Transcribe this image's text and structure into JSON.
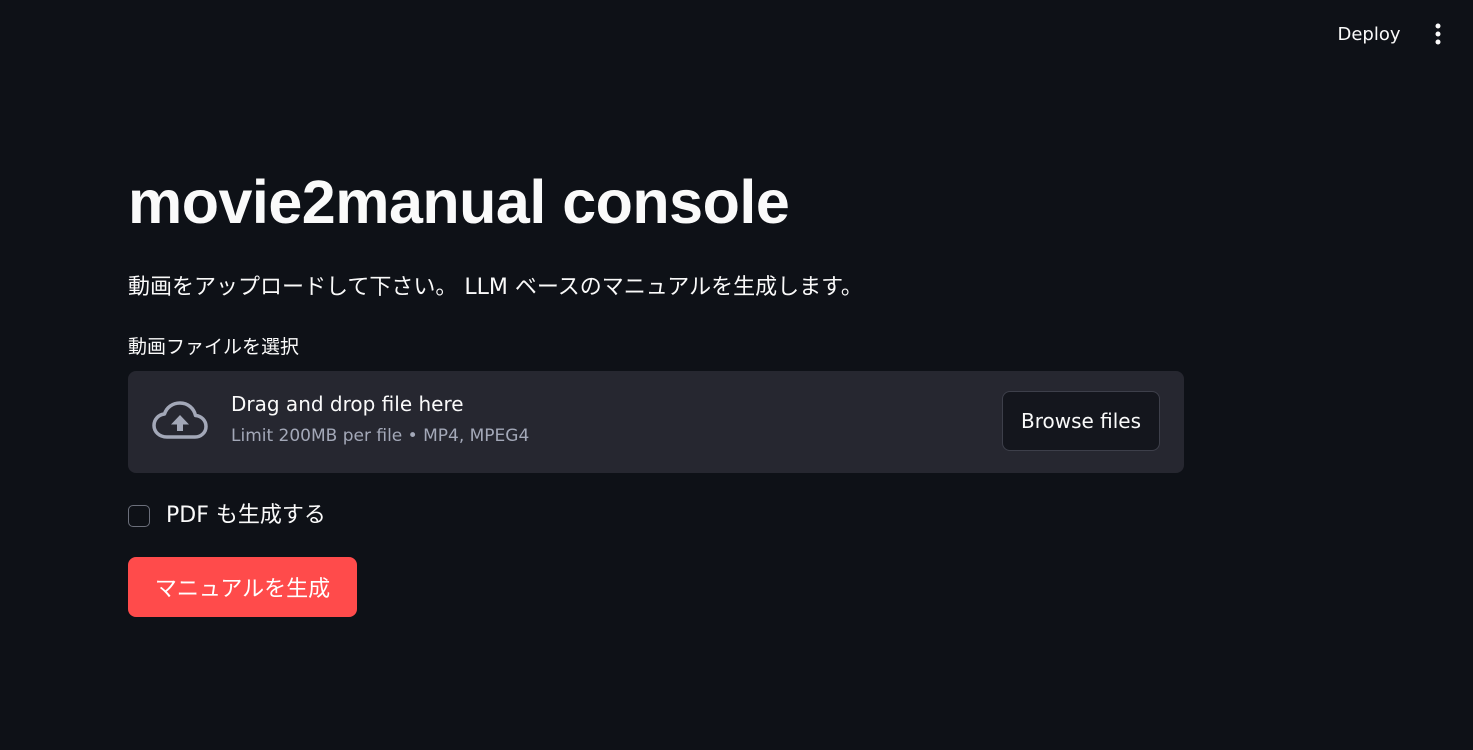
{
  "header": {
    "deploy_label": "Deploy",
    "menu_icon": "vertical-ellipsis-icon"
  },
  "main": {
    "title": "movie2manual console",
    "description": "動画をアップロードして下さい。 LLM ベースのマニュアルを生成します。",
    "uploader": {
      "label": "動画ファイルを選択",
      "icon": "cloud-upload-icon",
      "drop_text": "Drag and drop file here",
      "limit_text": "Limit 200MB per file • MP4, MPEG4",
      "browse_label": "Browse files"
    },
    "pdf_checkbox": {
      "label": "PDF も生成する",
      "checked": false
    },
    "generate_button": {
      "label": "マニュアルを生成"
    }
  },
  "colors": {
    "background": "#0e1117",
    "dropzone": "#262730",
    "primary": "#ff4b4b",
    "text": "#fafafa",
    "muted_text": "#a3a8b8"
  }
}
